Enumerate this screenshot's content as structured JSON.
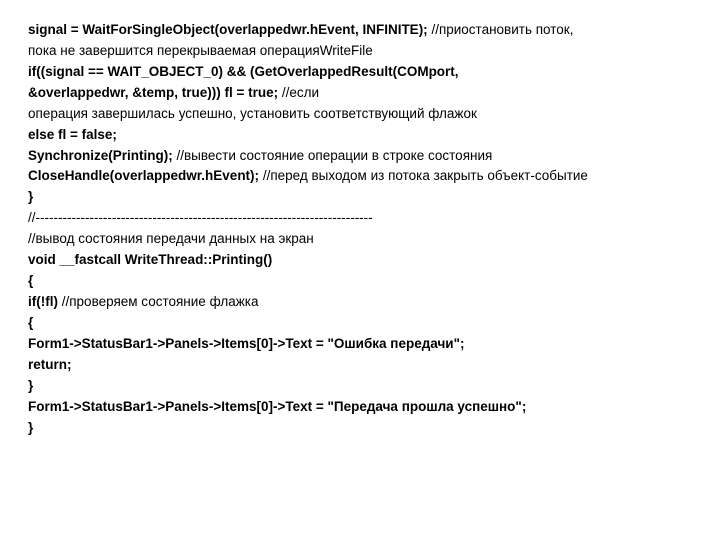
{
  "lines": [
    {
      "code": "signal = WaitForSingleObject(overlappedwr.hEvent, INFINITE);",
      "comment": "   //приостановить поток,"
    },
    {
      "code": "",
      "comment": " пока не завершится перекрываемая операцияWriteFile"
    },
    {
      "code": "if((signal == WAIT_OBJECT_0) && (GetOverlappedResult(COMport,",
      "comment": ""
    },
    {
      "code": "&overlappedwr, &temp, true))) fl = true;",
      "comment": " //если"
    },
    {
      "code": "",
      "comment": "операция завершилась успешно, установить соответствующий флажок"
    },
    {
      "code": "else fl = false;",
      "comment": ""
    },
    {
      "code": "Synchronize(Printing);",
      "comment": "  //вывести состояние операции в строке состояния"
    },
    {
      "code": "CloseHandle(overlappedwr.hEvent);",
      "comment": "  //перед выходом из потока закрыть объект-событие"
    },
    {
      "code": "}",
      "comment": ""
    },
    {
      "code": "",
      "comment": "//---------------------------------------------------------------------------"
    },
    {
      "code": "",
      "comment": "//вывод состояния передачи данных на экран"
    },
    {
      "code": "void __fastcall WriteThread::Printing()",
      "comment": ""
    },
    {
      "code": "{",
      "comment": ""
    },
    {
      "code": "if(!fl)",
      "comment": "  //проверяем состояние флажка"
    },
    {
      "code": "{",
      "comment": ""
    },
    {
      "code": "Form1->StatusBar1->Panels->Items[0]->Text = \"Ошибка передачи\";",
      "comment": ""
    },
    {
      "code": "return;",
      "comment": ""
    },
    {
      "code": "}",
      "comment": ""
    },
    {
      "code": "Form1->StatusBar1->Panels->Items[0]->Text = \"Передача прошла успешно\";",
      "comment": ""
    },
    {
      "code": "}",
      "comment": ""
    }
  ]
}
